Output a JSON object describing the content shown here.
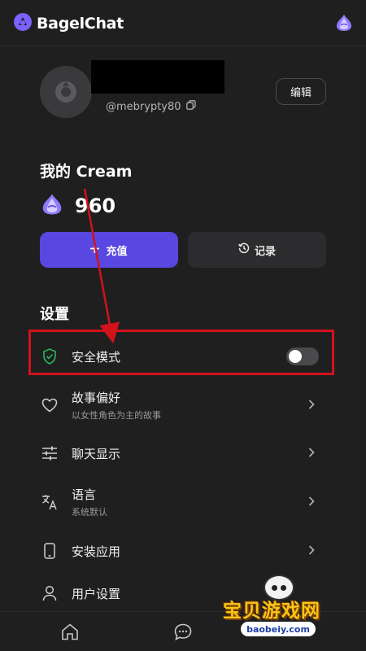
{
  "app": {
    "brand_name": "BagelChat",
    "brand_color": "#7b61ff",
    "header_icon": "cream-icon"
  },
  "profile": {
    "handle": "@mebrypty80",
    "edit_label": "编辑",
    "copy_icon": "copy-icon"
  },
  "cream": {
    "title": "我的 Cream",
    "balance": "960",
    "recharge_label": "充值",
    "history_label": "记录"
  },
  "settings": {
    "title": "设置",
    "items": [
      {
        "label": "安全模式",
        "icon": "shield-check-icon",
        "type": "toggle",
        "enabled": false
      },
      {
        "label": "故事偏好",
        "sub": "以女性角色为主的故事",
        "icon": "heart-icon",
        "type": "link"
      },
      {
        "label": "聊天显示",
        "icon": "sliders-icon",
        "type": "link"
      },
      {
        "label": "语言",
        "sub": "系统默认",
        "icon": "translate-icon",
        "type": "link"
      },
      {
        "label": "安装应用",
        "icon": "phone-icon",
        "type": "link"
      },
      {
        "label": "用户设置",
        "icon": "user-icon",
        "type": "link"
      }
    ]
  },
  "nav": {
    "items": [
      "home-icon",
      "chat-icon"
    ]
  },
  "watermark": {
    "title": "宝贝游戏网",
    "url": "baobeiy.com"
  },
  "colors": {
    "accent": "#5847e0",
    "annotation": "#d2121b",
    "safe_icon": "#2fb35b"
  }
}
